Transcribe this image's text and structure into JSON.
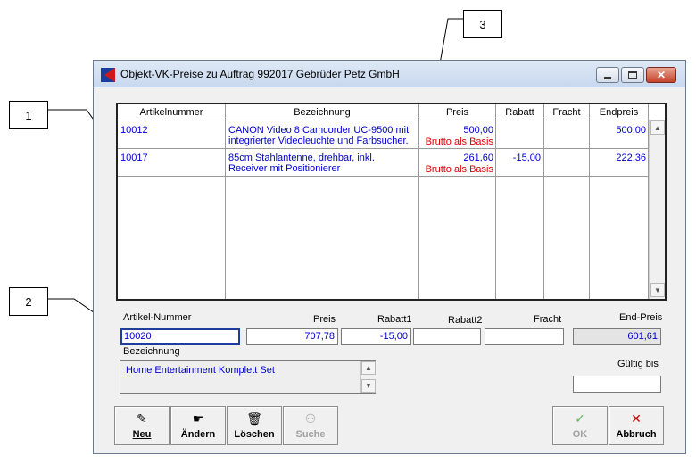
{
  "callouts": [
    "1",
    "2",
    "3"
  ],
  "window": {
    "title": "Objekt-VK-Preise zu Auftrag 992017 Gebrüder Petz GmbH",
    "controls": {
      "minimize": "minimize-icon",
      "maximize": "maximize-icon",
      "close": "close-icon"
    }
  },
  "grid": {
    "headers": [
      "Artikelnummer",
      "Bezeichnung",
      "Preis",
      "Rabatt",
      "Fracht",
      "Endpreis"
    ],
    "rows": [
      {
        "artikelnummer": "10012",
        "bezeichnung_1": "CANON Video 8 Camcorder UC-9500 mit",
        "bezeichnung_2": "integrierter Videoleuchte und Farbsucher.",
        "preis": "500,00",
        "preis_note": "Brutto als Basis",
        "rabatt": "",
        "fracht": "",
        "endpreis": "500,00"
      },
      {
        "artikelnummer": "10017",
        "bezeichnung_1": "85cm Stahlantenne, drehbar, inkl.",
        "bezeichnung_2": "Receiver mit Positionierer",
        "preis": "261,60",
        "preis_note": "Brutto als Basis",
        "rabatt": "-15,00",
        "fracht": "",
        "endpreis": "222,36"
      }
    ]
  },
  "form": {
    "labels": {
      "artikel_nummer": "Artikel-Nummer",
      "preis": "Preis",
      "rabatt1": "Rabatt1",
      "rabatt2": "Rabatt2",
      "fracht": "Fracht",
      "end_preis": "End-Preis",
      "bezeichnung": "Bezeichnung",
      "gueltig_bis": "Gültig bis"
    },
    "values": {
      "artikel_nummer": "10020",
      "preis": "707,78",
      "rabatt1": "-15,00",
      "rabatt2": "",
      "fracht": "",
      "end_preis": "601,61",
      "bezeichnung": "Home Entertainment Komplett Set",
      "gueltig_bis": ""
    }
  },
  "toolbar": {
    "neu": {
      "label": "Neu",
      "icon": "pencil-icon"
    },
    "aendern": {
      "label": "Ändern",
      "icon": "edit-hand-icon"
    },
    "loeschen": {
      "label": "Löschen",
      "icon": "trash-icon"
    },
    "suche": {
      "label": "Suche",
      "icon": "binoculars-icon"
    },
    "ok": {
      "label": "OK",
      "icon": "checkmark-icon"
    },
    "abbruch": {
      "label": "Abbruch",
      "icon": "x-icon"
    }
  }
}
